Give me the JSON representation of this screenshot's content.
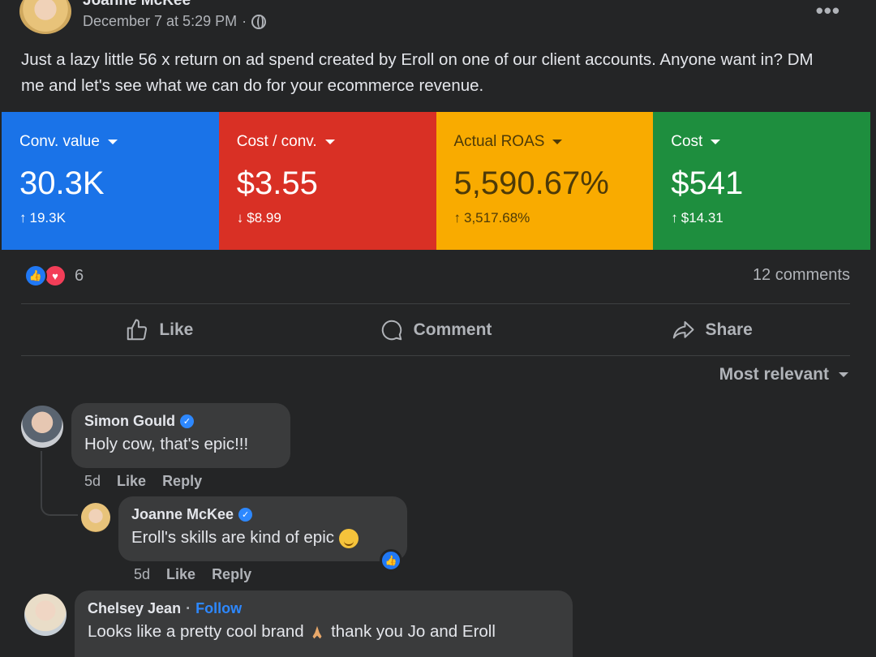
{
  "post": {
    "author": "Joanne McKee",
    "timestamp": "December 7 at 5:29 PM",
    "privacy_icon": "globe-icon",
    "more_label": "•••",
    "text": "Just a lazy little 56 x return on ad spend created by Eroll on one of our client accounts. Anyone want in? DM me and let's see what we can do for your ecommerce revenue."
  },
  "cards": [
    {
      "label": "Conv. value",
      "value": "30.3K",
      "delta": "19.3K",
      "direction": "up",
      "color": "#1a73e8"
    },
    {
      "label": "Cost / conv.",
      "value": "$3.55",
      "delta": "$8.99",
      "direction": "down",
      "color": "#d93025"
    },
    {
      "label": "Actual ROAS",
      "value": "5,590.67%",
      "delta": "3,517.68%",
      "direction": "up",
      "color": "#f9ab00"
    },
    {
      "label": "Cost",
      "value": "$541",
      "delta": "$14.31",
      "direction": "up",
      "color": "#1e8e3e"
    }
  ],
  "reactions": {
    "count": "6",
    "comments": "12 comments"
  },
  "actions": {
    "like": "Like",
    "comment": "Comment",
    "share": "Share"
  },
  "sort": {
    "label": "Most relevant"
  },
  "comments": [
    {
      "name": "Simon Gould",
      "text": "Holy cow, that's epic!!!",
      "time": "5d",
      "like": "Like",
      "reply": "Reply"
    },
    {
      "name": "Joanne McKee",
      "text": "Eroll's skills are kind of epic",
      "time": "5d",
      "like": "Like",
      "reply": "Reply"
    },
    {
      "name": "Chelsey Jean",
      "follow": "Follow",
      "text_before": "Looks like a pretty cool brand",
      "text_after": "thank you Jo and Eroll"
    }
  ]
}
